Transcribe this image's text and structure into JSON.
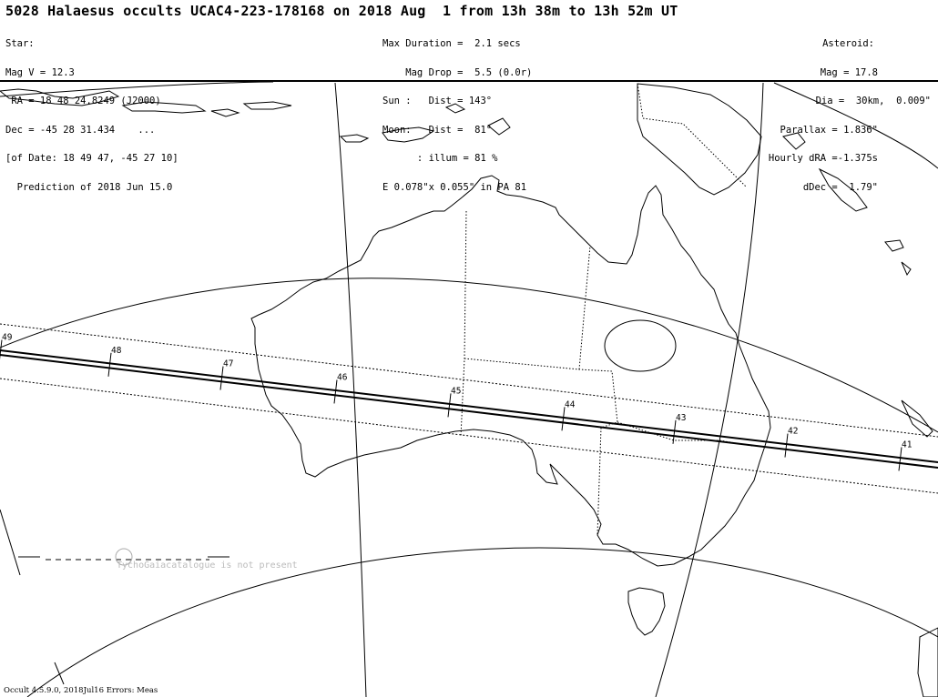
{
  "header": {
    "title": "5028 Halaesus occults UCAC4-223-178168 on 2018 Aug  1 from 13h 38m to 13h 52m UT",
    "star": [
      "Star:",
      "Mag V = 12.3",
      " RA = 18 48 24.8249 (J2000)",
      "Dec = -45 28 31.434    ...",
      "[of Date: 18 49 47, -45 27 10]",
      "  Prediction of 2018 Jun 15.0"
    ],
    "event": [
      "Max Duration =  2.1 secs",
      "    Mag Drop =  5.5 (0.0r)",
      "Sun :   Dist = 143°",
      "Moon:   Dist =  81°",
      "      : illum = 81 %",
      "E 0.078\"x 0.055\" in PA 81"
    ],
    "asteroid": [
      "Asteroid:",
      "Mag = 17.8",
      "Dia =  30km,  0.009\"",
      "Parallax = 1.836\"",
      "Hourly dRA =-1.375s",
      "dDec =  1.79\""
    ]
  },
  "map": {
    "path_time_labels": [
      "49",
      "48",
      "47",
      "46",
      "45",
      "44",
      "43",
      "42",
      "41"
    ],
    "notice": "TychoGaiacatalogue is not present"
  },
  "footer": "Occult 4.5.9.0, 2018Jul16 Errors: Meas",
  "colors": {
    "background": "#ffffff",
    "lines": "#000000",
    "notice": "#bbbbbb"
  }
}
